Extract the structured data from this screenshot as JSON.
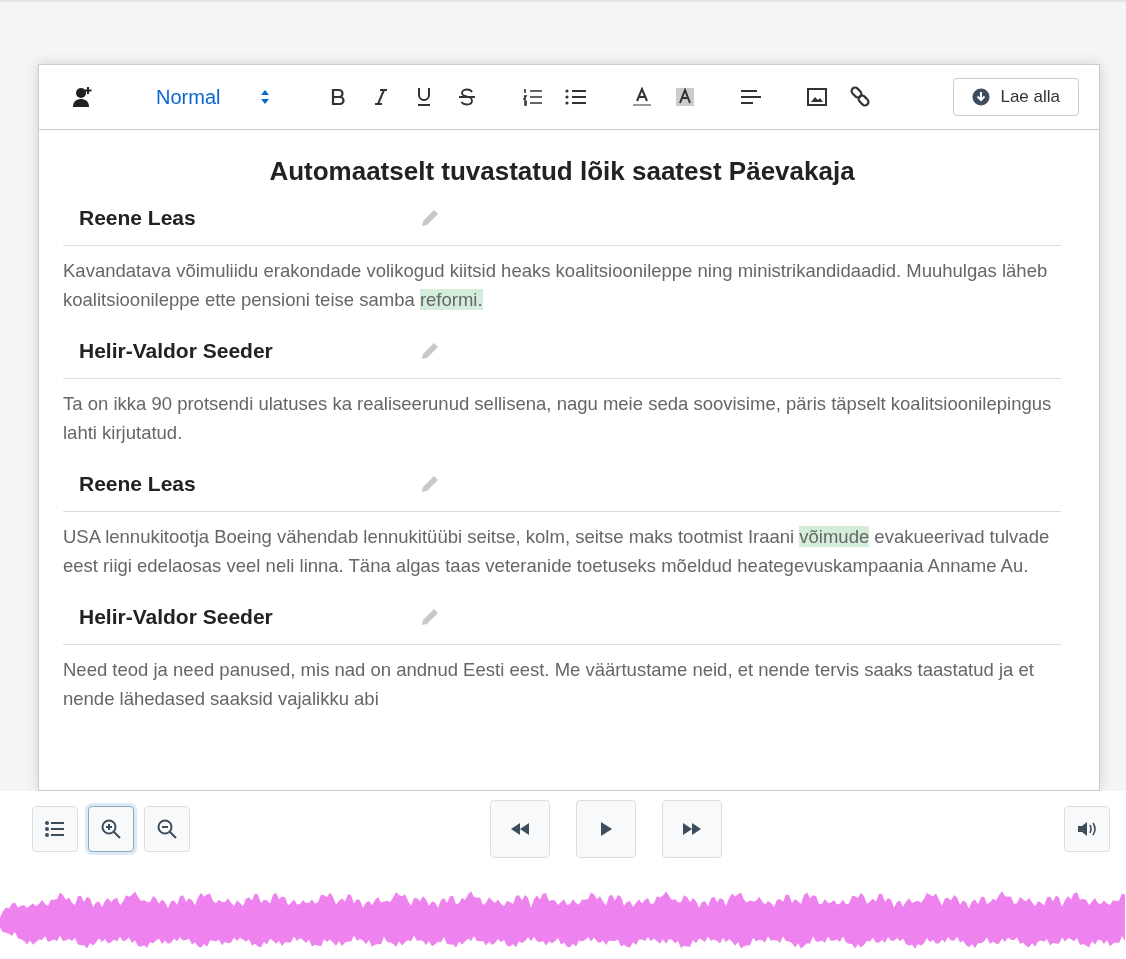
{
  "toolbar": {
    "format": "Normal",
    "download": "Lae alla"
  },
  "document": {
    "title": "Automaatselt tuvastatud lõik saatest Päevakaja",
    "turns": [
      {
        "speaker": "Reene Leas",
        "text": [
          {
            "text": "Kavandatava võimuliidu erakondade volikogud kiitsid heaks koalitsioonileppe ning ministrikandidaadid. Muuhulgas läheb koalitsioonileppe ette pensioni teise samba ",
            "highlighted": false
          },
          {
            "text": "reformi.",
            "highlighted": true
          }
        ]
      },
      {
        "speaker": "Helir-Valdor Seeder",
        "text": [
          {
            "text": "Ta on ikka 90 protsendi ulatuses ka realiseerunud sellisena, nagu meie seda soovisime, päris täpselt koalitsioonilepingus lahti kirjutatud.",
            "highlighted": false
          }
        ]
      },
      {
        "speaker": "Reene Leas",
        "text": [
          {
            "text": "USA lennukitootja Boeing vähendab lennukitüübi seitse, kolm, seitse maks tootmist Iraani ",
            "highlighted": false
          },
          {
            "text": "võimude",
            "highlighted": true
          },
          {
            "text": " evakueerivad tulvade eest riigi edelaosas veel neli linna. Täna algas taas veteranide toetuseks mõeldud heategevuskampaania Anname Au.",
            "highlighted": false
          }
        ]
      },
      {
        "speaker": "Helir-Valdor Seeder",
        "text": [
          {
            "text": "Need teod ja need panused, mis nad on andnud Eesti eest. Me väärtustame neid, et nende tervis saaks taastatud ja et nende lähedased saaksid vajalikku abi",
            "highlighted": false
          }
        ]
      }
    ]
  },
  "player": {
    "zoom_in_selected": true
  }
}
